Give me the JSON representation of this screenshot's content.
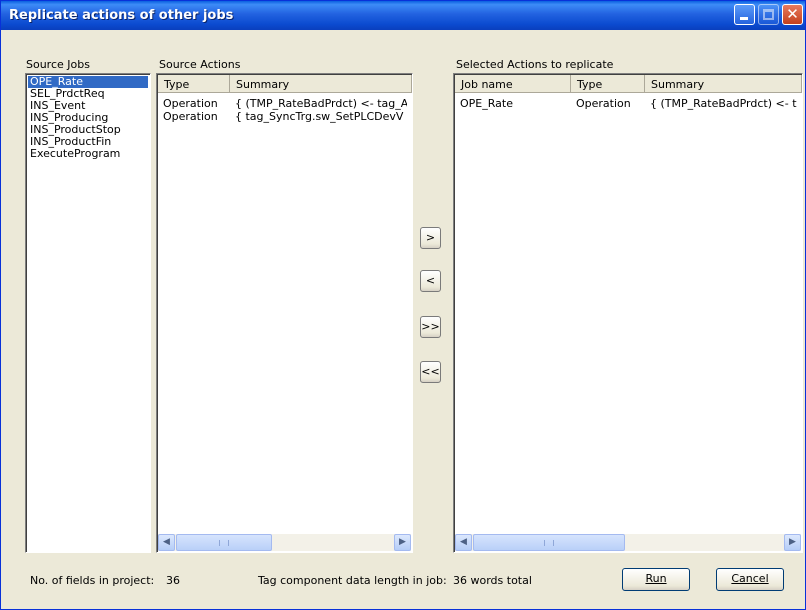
{
  "window": {
    "title": "Replicate actions of other jobs"
  },
  "source_jobs": {
    "label": "Source Jobs",
    "items": [
      "OPE_Rate",
      "SEL_PrdctReq",
      "INS_Event",
      "INS_Producing",
      "INS_ProductStop",
      "INS_ProductFin",
      "ExecuteProgram"
    ],
    "selected": "OPE_Rate"
  },
  "source_actions": {
    "label": "Source Actions",
    "columns": [
      "Type",
      "Summary"
    ],
    "rows": [
      [
        "Operation",
        "{ (TMP_RateBadPrdct) <- tag_A"
      ],
      [
        "Operation",
        "{ tag_SyncTrg.sw_SetPLCDevV"
      ]
    ]
  },
  "selected_actions": {
    "label": "Selected Actions to replicate",
    "columns": [
      "Job name",
      "Type",
      "Summary"
    ],
    "rows": [
      [
        "OPE_Rate",
        "Operation",
        "{ (TMP_RateBadPrdct) <- t"
      ]
    ]
  },
  "move_buttons": [
    ">",
    "<",
    ">>",
    "<<"
  ],
  "footer": {
    "fields_label": "No. of fields in project:",
    "fields_value": "36",
    "tag_label": "Tag component data length in job:",
    "tag_value": "36 words total"
  },
  "buttons": {
    "run": "Run",
    "cancel": "Cancel"
  }
}
